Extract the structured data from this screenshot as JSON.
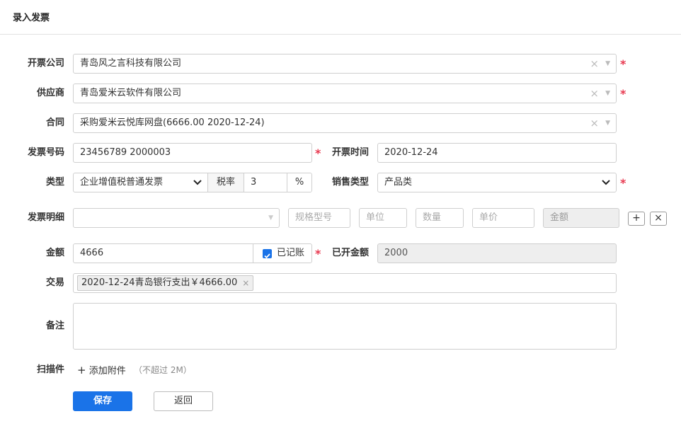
{
  "page": {
    "title": "录入发票"
  },
  "form": {
    "company": {
      "label": "开票公司",
      "value": "青岛风之言科技有限公司"
    },
    "supplier": {
      "label": "供应商",
      "value": "青岛爱米云软件有限公司"
    },
    "contract": {
      "label": "合同",
      "value": "采购爱米云悦库网盘(6666.00 2020-12-24)"
    },
    "invoice_no": {
      "label": "发票号码",
      "value": "23456789 2000003"
    },
    "invoice_date": {
      "label": "开票时间",
      "value": "2020-12-24"
    },
    "type": {
      "label": "类型",
      "value": "企业增值税普通发票"
    },
    "tax_rate": {
      "label": "税率",
      "value": "3",
      "unit": "%"
    },
    "sales_type": {
      "label": "销售类型",
      "value": "产品类"
    },
    "details": {
      "label": "发票明细",
      "spec_placeholder": "规格型号",
      "unit_placeholder": "单位",
      "qty_placeholder": "数量",
      "price_placeholder": "单价",
      "amount_placeholder": "金额",
      "add_symbol": "+",
      "remove_symbol": "×"
    },
    "amount": {
      "label": "金额",
      "value": "4666",
      "checkbox_label": "已记账",
      "checked": true
    },
    "invoiced_amount": {
      "label": "已开金额",
      "value": "2000"
    },
    "transaction": {
      "label": "交易",
      "tag": "2020-12-24青岛银行支出￥4666.00"
    },
    "remark": {
      "label": "备注",
      "value": ""
    },
    "scan": {
      "label": "扫描件",
      "add_label": "添加附件",
      "hint": "（不超过 2M）"
    },
    "required_mark": "*",
    "clear_symbol": "×",
    "dropdown_symbol": "▼"
  },
  "actions": {
    "save": "保存",
    "back": "返回"
  },
  "colors": {
    "primary": "#1a73e8",
    "required": "#e8384f",
    "disabled_bg": "#eeeeee"
  }
}
